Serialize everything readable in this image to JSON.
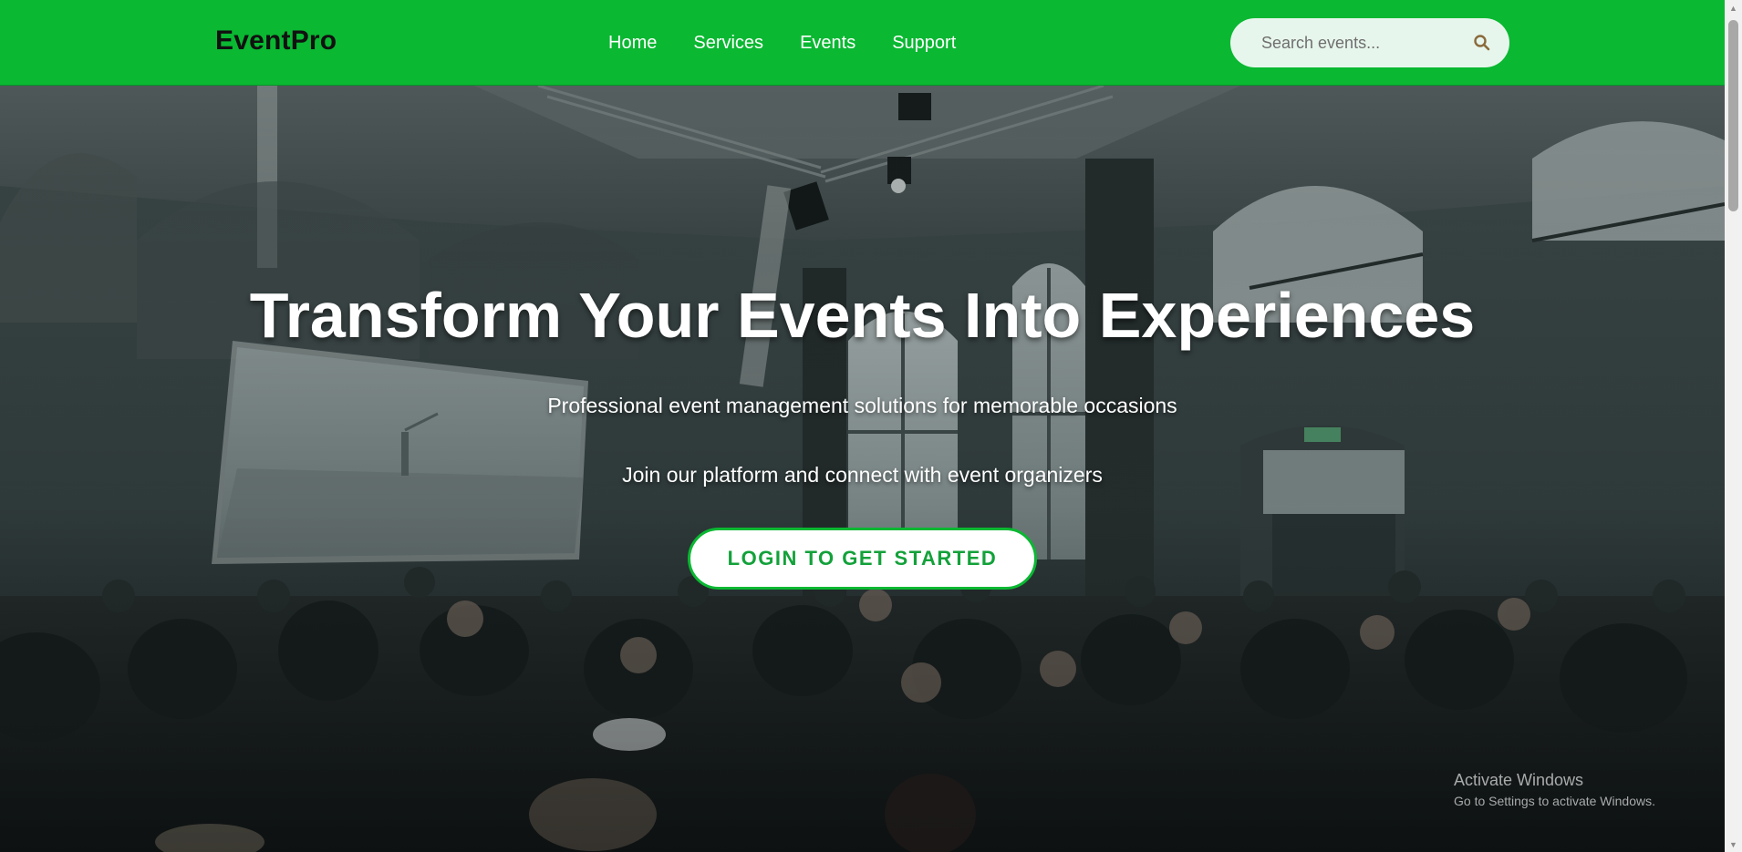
{
  "header": {
    "brand": "EventPro",
    "nav": [
      {
        "label": "Home"
      },
      {
        "label": "Services"
      },
      {
        "label": "Events"
      },
      {
        "label": "Support"
      }
    ],
    "search": {
      "placeholder": "Search events...",
      "icon": "search-icon"
    }
  },
  "hero": {
    "title": "Transform Your Events Into Experiences",
    "subtitle": "Professional event management solutions for memorable occasions",
    "note": "Join our platform and connect with event organizers",
    "cta_label": "LOGIN TO GET STARTED"
  },
  "watermark": {
    "title": "Activate Windows",
    "subtitle": "Go to Settings to activate Windows."
  },
  "colors": {
    "nav_bg": "#0ab832",
    "cta_text": "#13a13a",
    "search_bg": "#e7f6ec"
  }
}
